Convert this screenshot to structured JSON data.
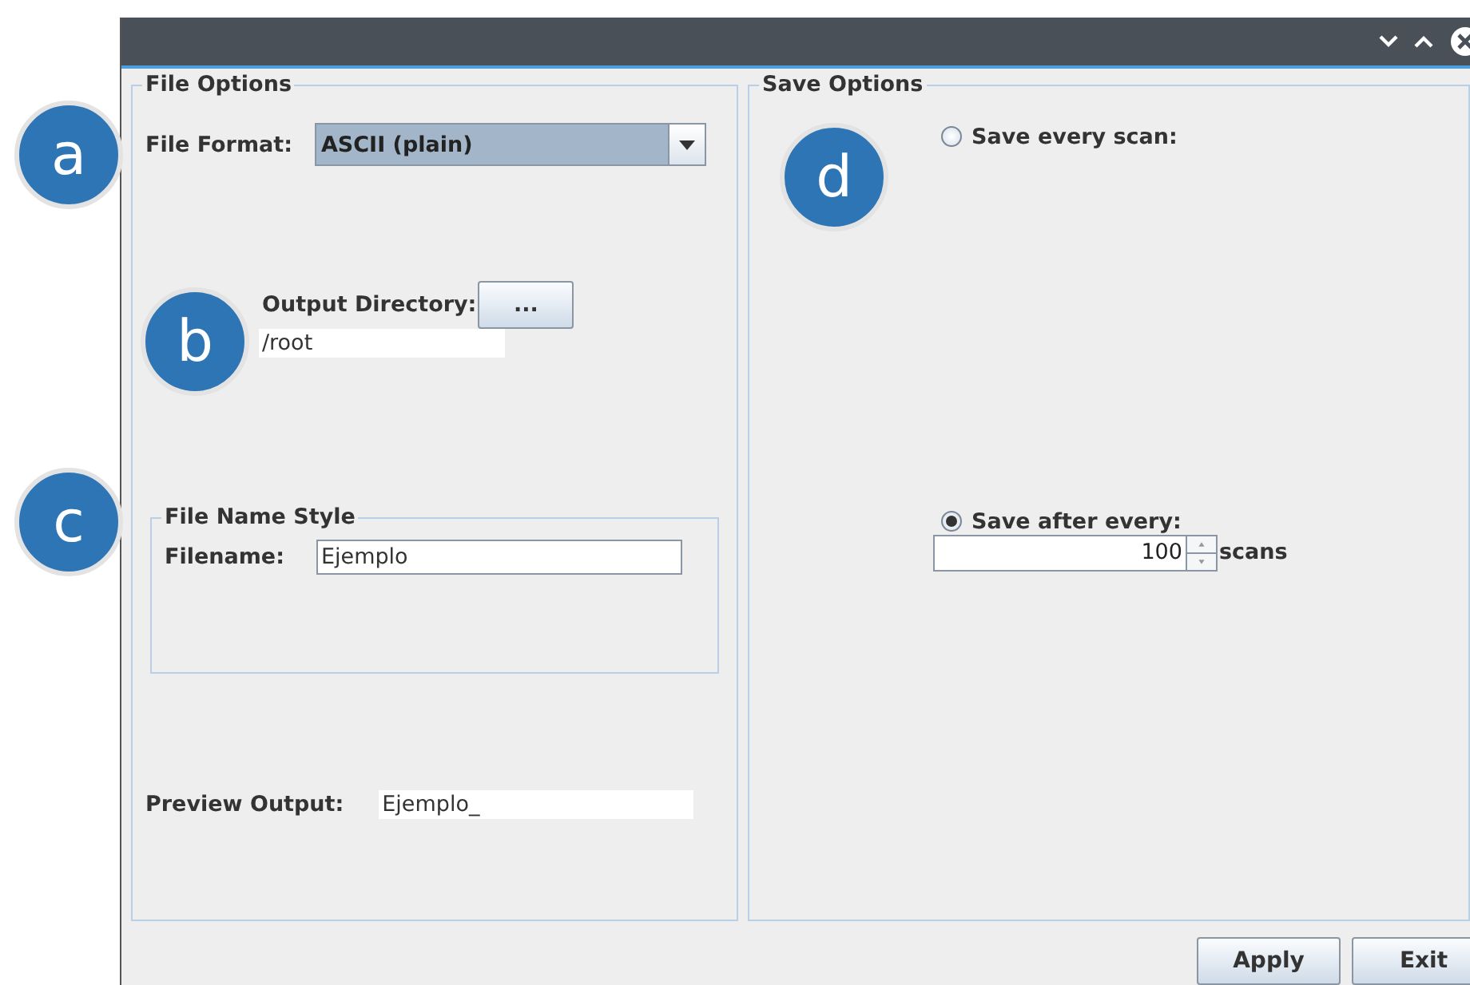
{
  "markers": [
    {
      "letter": "a"
    },
    {
      "letter": "b"
    },
    {
      "letter": "c"
    },
    {
      "letter": "d"
    }
  ],
  "file_options": {
    "title": "File Options",
    "file_format": {
      "label": "File Format:",
      "value": "ASCII (plain)"
    },
    "output_directory": {
      "label": "Output Directory:",
      "button": "...",
      "value": "/root"
    },
    "file_name_style": {
      "title": "File Name Style",
      "label": "Filename:",
      "value": "Ejemplo"
    },
    "preview_output": {
      "label": "Preview Output:",
      "value": "Ejemplo_"
    }
  },
  "save_options": {
    "title": "Save Options",
    "options": [
      {
        "label": "Save every scan:",
        "selected": false
      },
      {
        "label": "Save after every:",
        "selected": true,
        "spinner": {
          "value": "100",
          "unit": "scans"
        }
      }
    ]
  },
  "buttons": [
    "Apply",
    "Exit"
  ]
}
